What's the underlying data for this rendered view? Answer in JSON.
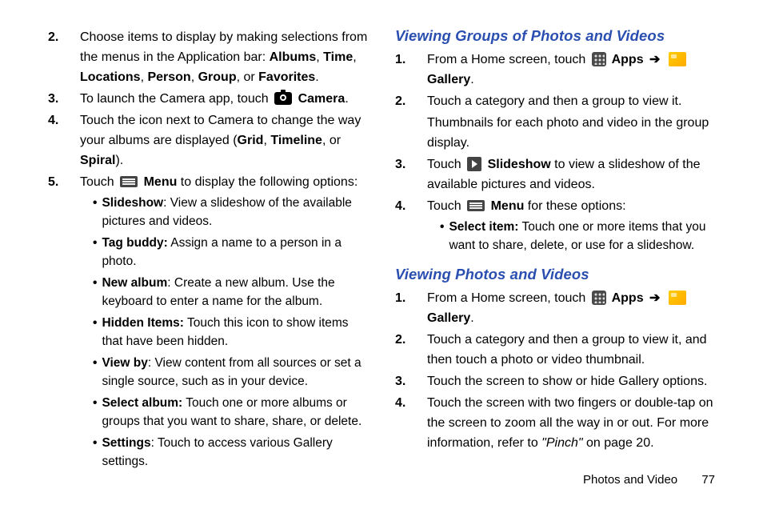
{
  "left": {
    "items": [
      {
        "num": "2.",
        "segs": [
          {
            "t": "Choose items to display by making selections from the menus in the Application bar: "
          },
          {
            "t": "Albums",
            "b": true
          },
          {
            "t": ", "
          },
          {
            "t": "Time",
            "b": true
          },
          {
            "t": ", "
          },
          {
            "t": "Locations",
            "b": true
          },
          {
            "t": ", "
          },
          {
            "t": "Person",
            "b": true
          },
          {
            "t": ", "
          },
          {
            "t": "Group",
            "b": true
          },
          {
            "t": ", or "
          },
          {
            "t": "Favorites",
            "b": true
          },
          {
            "t": "."
          }
        ]
      },
      {
        "num": "3.",
        "segs": [
          {
            "t": "To launch the Camera app, touch "
          },
          {
            "icon": "camera-icon"
          },
          {
            "t": " Camera",
            "b": true
          },
          {
            "t": "."
          }
        ]
      },
      {
        "num": "4.",
        "segs": [
          {
            "t": "Touch the icon next to Camera to change the way your albums are displayed ("
          },
          {
            "t": "Grid",
            "b": true
          },
          {
            "t": ", "
          },
          {
            "t": "Timeline",
            "b": true
          },
          {
            "t": ", or "
          },
          {
            "t": "Spiral",
            "b": true
          },
          {
            "t": ")."
          }
        ]
      },
      {
        "num": "5.",
        "segs": [
          {
            "t": "Touch "
          },
          {
            "icon": "menu-icon"
          },
          {
            "t": " Menu",
            "b": true
          },
          {
            "t": " to display the following options:"
          }
        ],
        "bullets": [
          [
            {
              "t": "Slideshow",
              "b": true
            },
            {
              "t": ": View a slideshow of the available pictures and videos."
            }
          ],
          [
            {
              "t": "Tag buddy:",
              "b": true
            },
            {
              "t": " Assign a name to a person in a photo."
            }
          ],
          [
            {
              "t": "New album",
              "b": true
            },
            {
              "t": ": Create a new album. Use the keyboard to enter a name for the album."
            }
          ],
          [
            {
              "t": "Hidden Items:",
              "b": true
            },
            {
              "t": "  Touch this icon to show items that have been hidden."
            }
          ],
          [
            {
              "t": "View by",
              "b": true
            },
            {
              "t": ": View content from all sources or set a single source, such as in your device."
            }
          ],
          [
            {
              "t": "Select album:",
              "b": true
            },
            {
              "t": " Touch one or more albums or groups that you want to share, share, or delete."
            }
          ],
          [
            {
              "t": "Settings",
              "b": true
            },
            {
              "t": ": Touch to access various Gallery settings."
            }
          ]
        ]
      }
    ]
  },
  "right": {
    "sections": [
      {
        "heading": "Viewing Groups of Photos and Videos",
        "items": [
          {
            "num": "1.",
            "segs": [
              {
                "t": "From a Home screen, touch "
              },
              {
                "icon": "apps-icon"
              },
              {
                "t": " Apps",
                "b": true
              },
              {
                "t": " ➔",
                "arrow": true
              },
              {
                "t": " "
              },
              {
                "icon": "gallery-icon"
              },
              {
                "t": " Gallery",
                "b": true
              },
              {
                "t": "."
              }
            ]
          },
          {
            "num": "2.",
            "segs": [
              {
                "t": "Touch a category and then a group to view it."
              }
            ],
            "after": [
              {
                "t": "Thumbnails for each photo and video in the group display."
              }
            ]
          },
          {
            "num": "3.",
            "segs": [
              {
                "t": "Touch "
              },
              {
                "icon": "play-icon"
              },
              {
                "t": " Slideshow",
                "b": true
              },
              {
                "t": " to view a slideshow of the available pictures and videos."
              }
            ]
          },
          {
            "num": "4.",
            "segs": [
              {
                "t": "Touch "
              },
              {
                "icon": "menu-icon"
              },
              {
                "t": " Menu",
                "b": true
              },
              {
                "t": " for these options:"
              }
            ],
            "bullets": [
              [
                {
                  "t": "Select item:",
                  "b": true
                },
                {
                  "t": " Touch one or more items that you want to share, delete, or use for a slideshow."
                }
              ]
            ]
          }
        ]
      },
      {
        "heading": "Viewing Photos and Videos",
        "items": [
          {
            "num": "1.",
            "segs": [
              {
                "t": "From a Home screen, touch "
              },
              {
                "icon": "apps-icon"
              },
              {
                "t": " Apps",
                "b": true
              },
              {
                "t": " ➔",
                "arrow": true
              },
              {
                "t": " "
              },
              {
                "icon": "gallery-icon"
              },
              {
                "t": " Gallery",
                "b": true
              },
              {
                "t": "."
              }
            ]
          },
          {
            "num": "2.",
            "segs": [
              {
                "t": "Touch a category and then a group to view it, and then touch a photo or video thumbnail."
              }
            ]
          },
          {
            "num": "3.",
            "segs": [
              {
                "t": "Touch the screen to show or hide Gallery options."
              }
            ]
          },
          {
            "num": "4.",
            "segs": [
              {
                "t": "Touch the screen with two fingers or double-tap on the screen to zoom all the way in or out. For more information, refer to "
              },
              {
                "t": "\"Pinch\"",
                "i": true
              },
              {
                "t": " on page 20."
              }
            ]
          }
        ]
      }
    ]
  },
  "footer": {
    "section": "Photos and Video",
    "page": "77"
  }
}
